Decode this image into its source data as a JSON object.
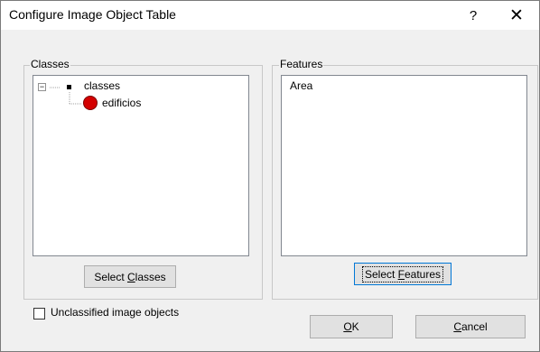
{
  "window": {
    "title": "Configure Image Object Table",
    "help_glyph": "?",
    "close_glyph": "✕"
  },
  "classes_group": {
    "label": "Classes",
    "tree": {
      "root_label": "classes",
      "child_label": "edificios",
      "child_color": "#d40000",
      "expander_glyph": "−"
    },
    "select_button": {
      "prefix": "Select ",
      "mnemonic": "C",
      "suffix": "lasses"
    },
    "unclassified_checkbox": {
      "label": "Unclassified image objects",
      "checked": false
    }
  },
  "features_group": {
    "label": "Features",
    "items": [
      "Area"
    ],
    "select_button": {
      "prefix": "Select ",
      "mnemonic": "F",
      "suffix": "eatures"
    }
  },
  "buttons": {
    "ok": {
      "mnemonic": "O",
      "suffix": "K"
    },
    "cancel": {
      "mnemonic": "C",
      "suffix": "ancel"
    }
  }
}
